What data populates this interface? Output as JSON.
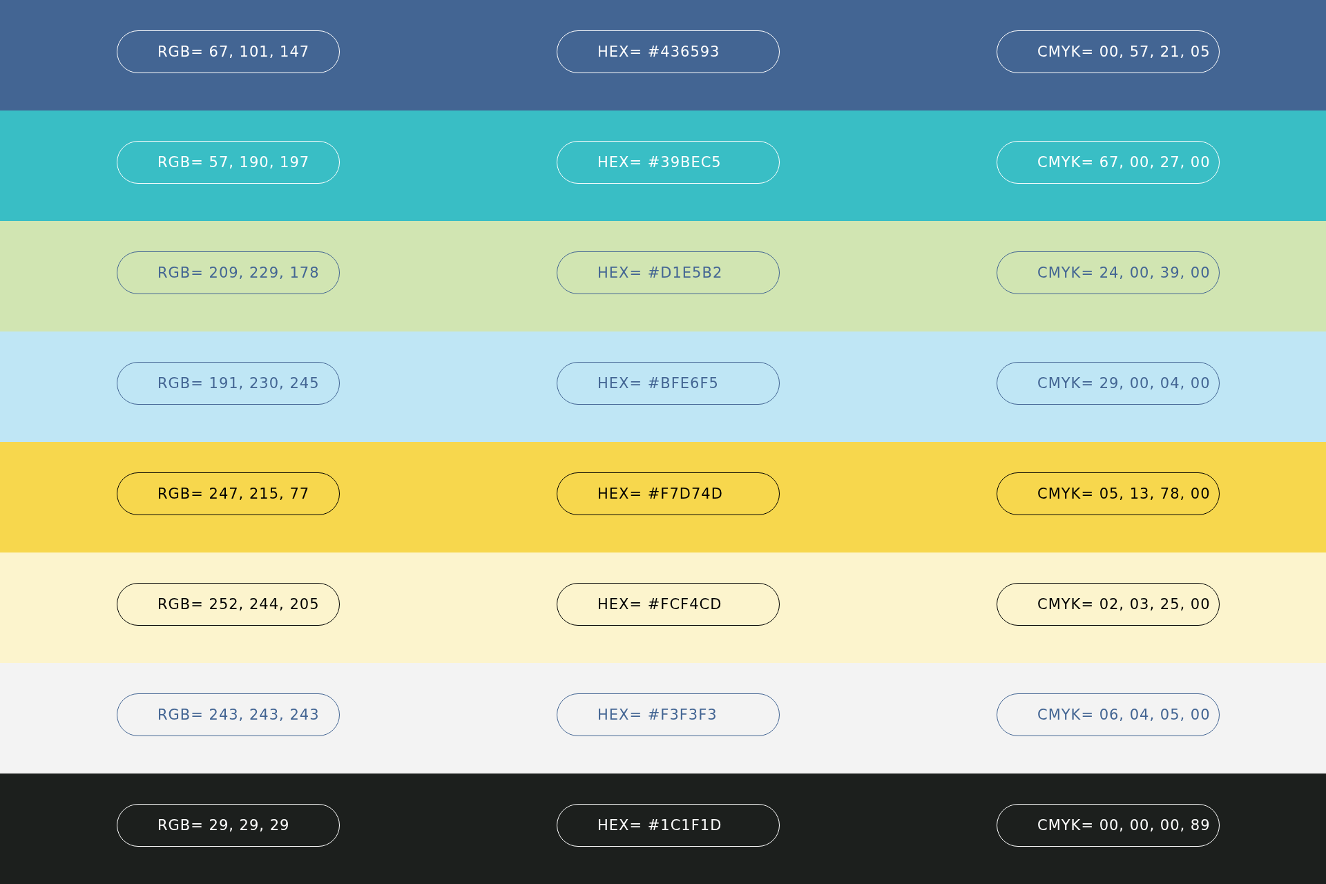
{
  "swatches": [
    {
      "color": "#436593",
      "kind": "white",
      "rgb": "RGB= 67, 101, 147",
      "hex": "HEX= #436593",
      "cmyk": "CMYK= 00, 57, 21, 05"
    },
    {
      "color": "#39bec5",
      "kind": "white",
      "rgb": "RGB= 57, 190, 197",
      "hex": "HEX= #39BEC5",
      "cmyk": "CMYK= 67, 00, 27, 00"
    },
    {
      "color": "#d1e5b2",
      "kind": "blue",
      "rgb": "RGB= 209, 229, 178",
      "hex": "HEX= #D1E5B2",
      "cmyk": "CMYK= 24, 00, 39, 00"
    },
    {
      "color": "#bfe6f5",
      "kind": "blue",
      "rgb": "RGB= 191, 230, 245",
      "hex": "HEX= #BFE6F5",
      "cmyk": "CMYK= 29, 00, 04, 00"
    },
    {
      "color": "#f7d74d",
      "kind": "black",
      "rgb": "RGB= 247, 215, 77",
      "hex": "HEX= #F7D74D",
      "cmyk": "CMYK= 05, 13, 78, 00"
    },
    {
      "color": "#fcf4cd",
      "kind": "black",
      "rgb": "RGB= 252, 244, 205",
      "hex": "HEX= #FCF4CD",
      "cmyk": "CMYK= 02, 03, 25, 00"
    },
    {
      "color": "#f3f3f3",
      "kind": "blue",
      "rgb": "RGB= 243, 243, 243",
      "hex": "HEX= #F3F3F3",
      "cmyk": "CMYK= 06, 04, 05, 00"
    },
    {
      "color": "#1c1f1d",
      "kind": "white",
      "rgb": "RGB= 29, 29, 29",
      "hex": "HEX= #1C1F1D",
      "cmyk": "CMYK= 00, 00, 00, 89"
    }
  ]
}
